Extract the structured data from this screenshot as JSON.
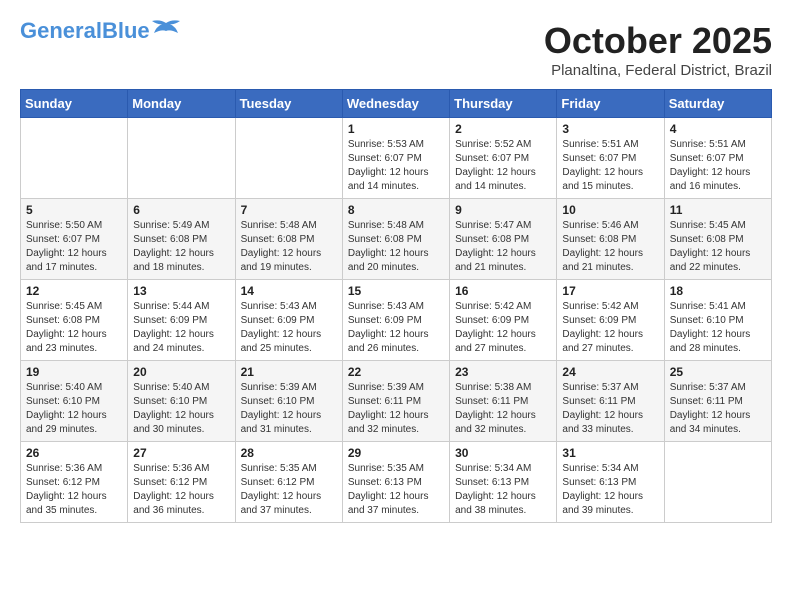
{
  "header": {
    "logo_line1": "General",
    "logo_line2": "Blue",
    "month": "October 2025",
    "location": "Planaltina, Federal District, Brazil"
  },
  "weekdays": [
    "Sunday",
    "Monday",
    "Tuesday",
    "Wednesday",
    "Thursday",
    "Friday",
    "Saturday"
  ],
  "weeks": [
    [
      {
        "day": "",
        "sunrise": "",
        "sunset": "",
        "daylight": ""
      },
      {
        "day": "",
        "sunrise": "",
        "sunset": "",
        "daylight": ""
      },
      {
        "day": "",
        "sunrise": "",
        "sunset": "",
        "daylight": ""
      },
      {
        "day": "1",
        "sunrise": "Sunrise: 5:53 AM",
        "sunset": "Sunset: 6:07 PM",
        "daylight": "Daylight: 12 hours and 14 minutes."
      },
      {
        "day": "2",
        "sunrise": "Sunrise: 5:52 AM",
        "sunset": "Sunset: 6:07 PM",
        "daylight": "Daylight: 12 hours and 14 minutes."
      },
      {
        "day": "3",
        "sunrise": "Sunrise: 5:51 AM",
        "sunset": "Sunset: 6:07 PM",
        "daylight": "Daylight: 12 hours and 15 minutes."
      },
      {
        "day": "4",
        "sunrise": "Sunrise: 5:51 AM",
        "sunset": "Sunset: 6:07 PM",
        "daylight": "Daylight: 12 hours and 16 minutes."
      }
    ],
    [
      {
        "day": "5",
        "sunrise": "Sunrise: 5:50 AM",
        "sunset": "Sunset: 6:07 PM",
        "daylight": "Daylight: 12 hours and 17 minutes."
      },
      {
        "day": "6",
        "sunrise": "Sunrise: 5:49 AM",
        "sunset": "Sunset: 6:08 PM",
        "daylight": "Daylight: 12 hours and 18 minutes."
      },
      {
        "day": "7",
        "sunrise": "Sunrise: 5:48 AM",
        "sunset": "Sunset: 6:08 PM",
        "daylight": "Daylight: 12 hours and 19 minutes."
      },
      {
        "day": "8",
        "sunrise": "Sunrise: 5:48 AM",
        "sunset": "Sunset: 6:08 PM",
        "daylight": "Daylight: 12 hours and 20 minutes."
      },
      {
        "day": "9",
        "sunrise": "Sunrise: 5:47 AM",
        "sunset": "Sunset: 6:08 PM",
        "daylight": "Daylight: 12 hours and 21 minutes."
      },
      {
        "day": "10",
        "sunrise": "Sunrise: 5:46 AM",
        "sunset": "Sunset: 6:08 PM",
        "daylight": "Daylight: 12 hours and 21 minutes."
      },
      {
        "day": "11",
        "sunrise": "Sunrise: 5:45 AM",
        "sunset": "Sunset: 6:08 PM",
        "daylight": "Daylight: 12 hours and 22 minutes."
      }
    ],
    [
      {
        "day": "12",
        "sunrise": "Sunrise: 5:45 AM",
        "sunset": "Sunset: 6:08 PM",
        "daylight": "Daylight: 12 hours and 23 minutes."
      },
      {
        "day": "13",
        "sunrise": "Sunrise: 5:44 AM",
        "sunset": "Sunset: 6:09 PM",
        "daylight": "Daylight: 12 hours and 24 minutes."
      },
      {
        "day": "14",
        "sunrise": "Sunrise: 5:43 AM",
        "sunset": "Sunset: 6:09 PM",
        "daylight": "Daylight: 12 hours and 25 minutes."
      },
      {
        "day": "15",
        "sunrise": "Sunrise: 5:43 AM",
        "sunset": "Sunset: 6:09 PM",
        "daylight": "Daylight: 12 hours and 26 minutes."
      },
      {
        "day": "16",
        "sunrise": "Sunrise: 5:42 AM",
        "sunset": "Sunset: 6:09 PM",
        "daylight": "Daylight: 12 hours and 27 minutes."
      },
      {
        "day": "17",
        "sunrise": "Sunrise: 5:42 AM",
        "sunset": "Sunset: 6:09 PM",
        "daylight": "Daylight: 12 hours and 27 minutes."
      },
      {
        "day": "18",
        "sunrise": "Sunrise: 5:41 AM",
        "sunset": "Sunset: 6:10 PM",
        "daylight": "Daylight: 12 hours and 28 minutes."
      }
    ],
    [
      {
        "day": "19",
        "sunrise": "Sunrise: 5:40 AM",
        "sunset": "Sunset: 6:10 PM",
        "daylight": "Daylight: 12 hours and 29 minutes."
      },
      {
        "day": "20",
        "sunrise": "Sunrise: 5:40 AM",
        "sunset": "Sunset: 6:10 PM",
        "daylight": "Daylight: 12 hours and 30 minutes."
      },
      {
        "day": "21",
        "sunrise": "Sunrise: 5:39 AM",
        "sunset": "Sunset: 6:10 PM",
        "daylight": "Daylight: 12 hours and 31 minutes."
      },
      {
        "day": "22",
        "sunrise": "Sunrise: 5:39 AM",
        "sunset": "Sunset: 6:11 PM",
        "daylight": "Daylight: 12 hours and 32 minutes."
      },
      {
        "day": "23",
        "sunrise": "Sunrise: 5:38 AM",
        "sunset": "Sunset: 6:11 PM",
        "daylight": "Daylight: 12 hours and 32 minutes."
      },
      {
        "day": "24",
        "sunrise": "Sunrise: 5:37 AM",
        "sunset": "Sunset: 6:11 PM",
        "daylight": "Daylight: 12 hours and 33 minutes."
      },
      {
        "day": "25",
        "sunrise": "Sunrise: 5:37 AM",
        "sunset": "Sunset: 6:11 PM",
        "daylight": "Daylight: 12 hours and 34 minutes."
      }
    ],
    [
      {
        "day": "26",
        "sunrise": "Sunrise: 5:36 AM",
        "sunset": "Sunset: 6:12 PM",
        "daylight": "Daylight: 12 hours and 35 minutes."
      },
      {
        "day": "27",
        "sunrise": "Sunrise: 5:36 AM",
        "sunset": "Sunset: 6:12 PM",
        "daylight": "Daylight: 12 hours and 36 minutes."
      },
      {
        "day": "28",
        "sunrise": "Sunrise: 5:35 AM",
        "sunset": "Sunset: 6:12 PM",
        "daylight": "Daylight: 12 hours and 37 minutes."
      },
      {
        "day": "29",
        "sunrise": "Sunrise: 5:35 AM",
        "sunset": "Sunset: 6:13 PM",
        "daylight": "Daylight: 12 hours and 37 minutes."
      },
      {
        "day": "30",
        "sunrise": "Sunrise: 5:34 AM",
        "sunset": "Sunset: 6:13 PM",
        "daylight": "Daylight: 12 hours and 38 minutes."
      },
      {
        "day": "31",
        "sunrise": "Sunrise: 5:34 AM",
        "sunset": "Sunset: 6:13 PM",
        "daylight": "Daylight: 12 hours and 39 minutes."
      },
      {
        "day": "",
        "sunrise": "",
        "sunset": "",
        "daylight": ""
      }
    ]
  ]
}
